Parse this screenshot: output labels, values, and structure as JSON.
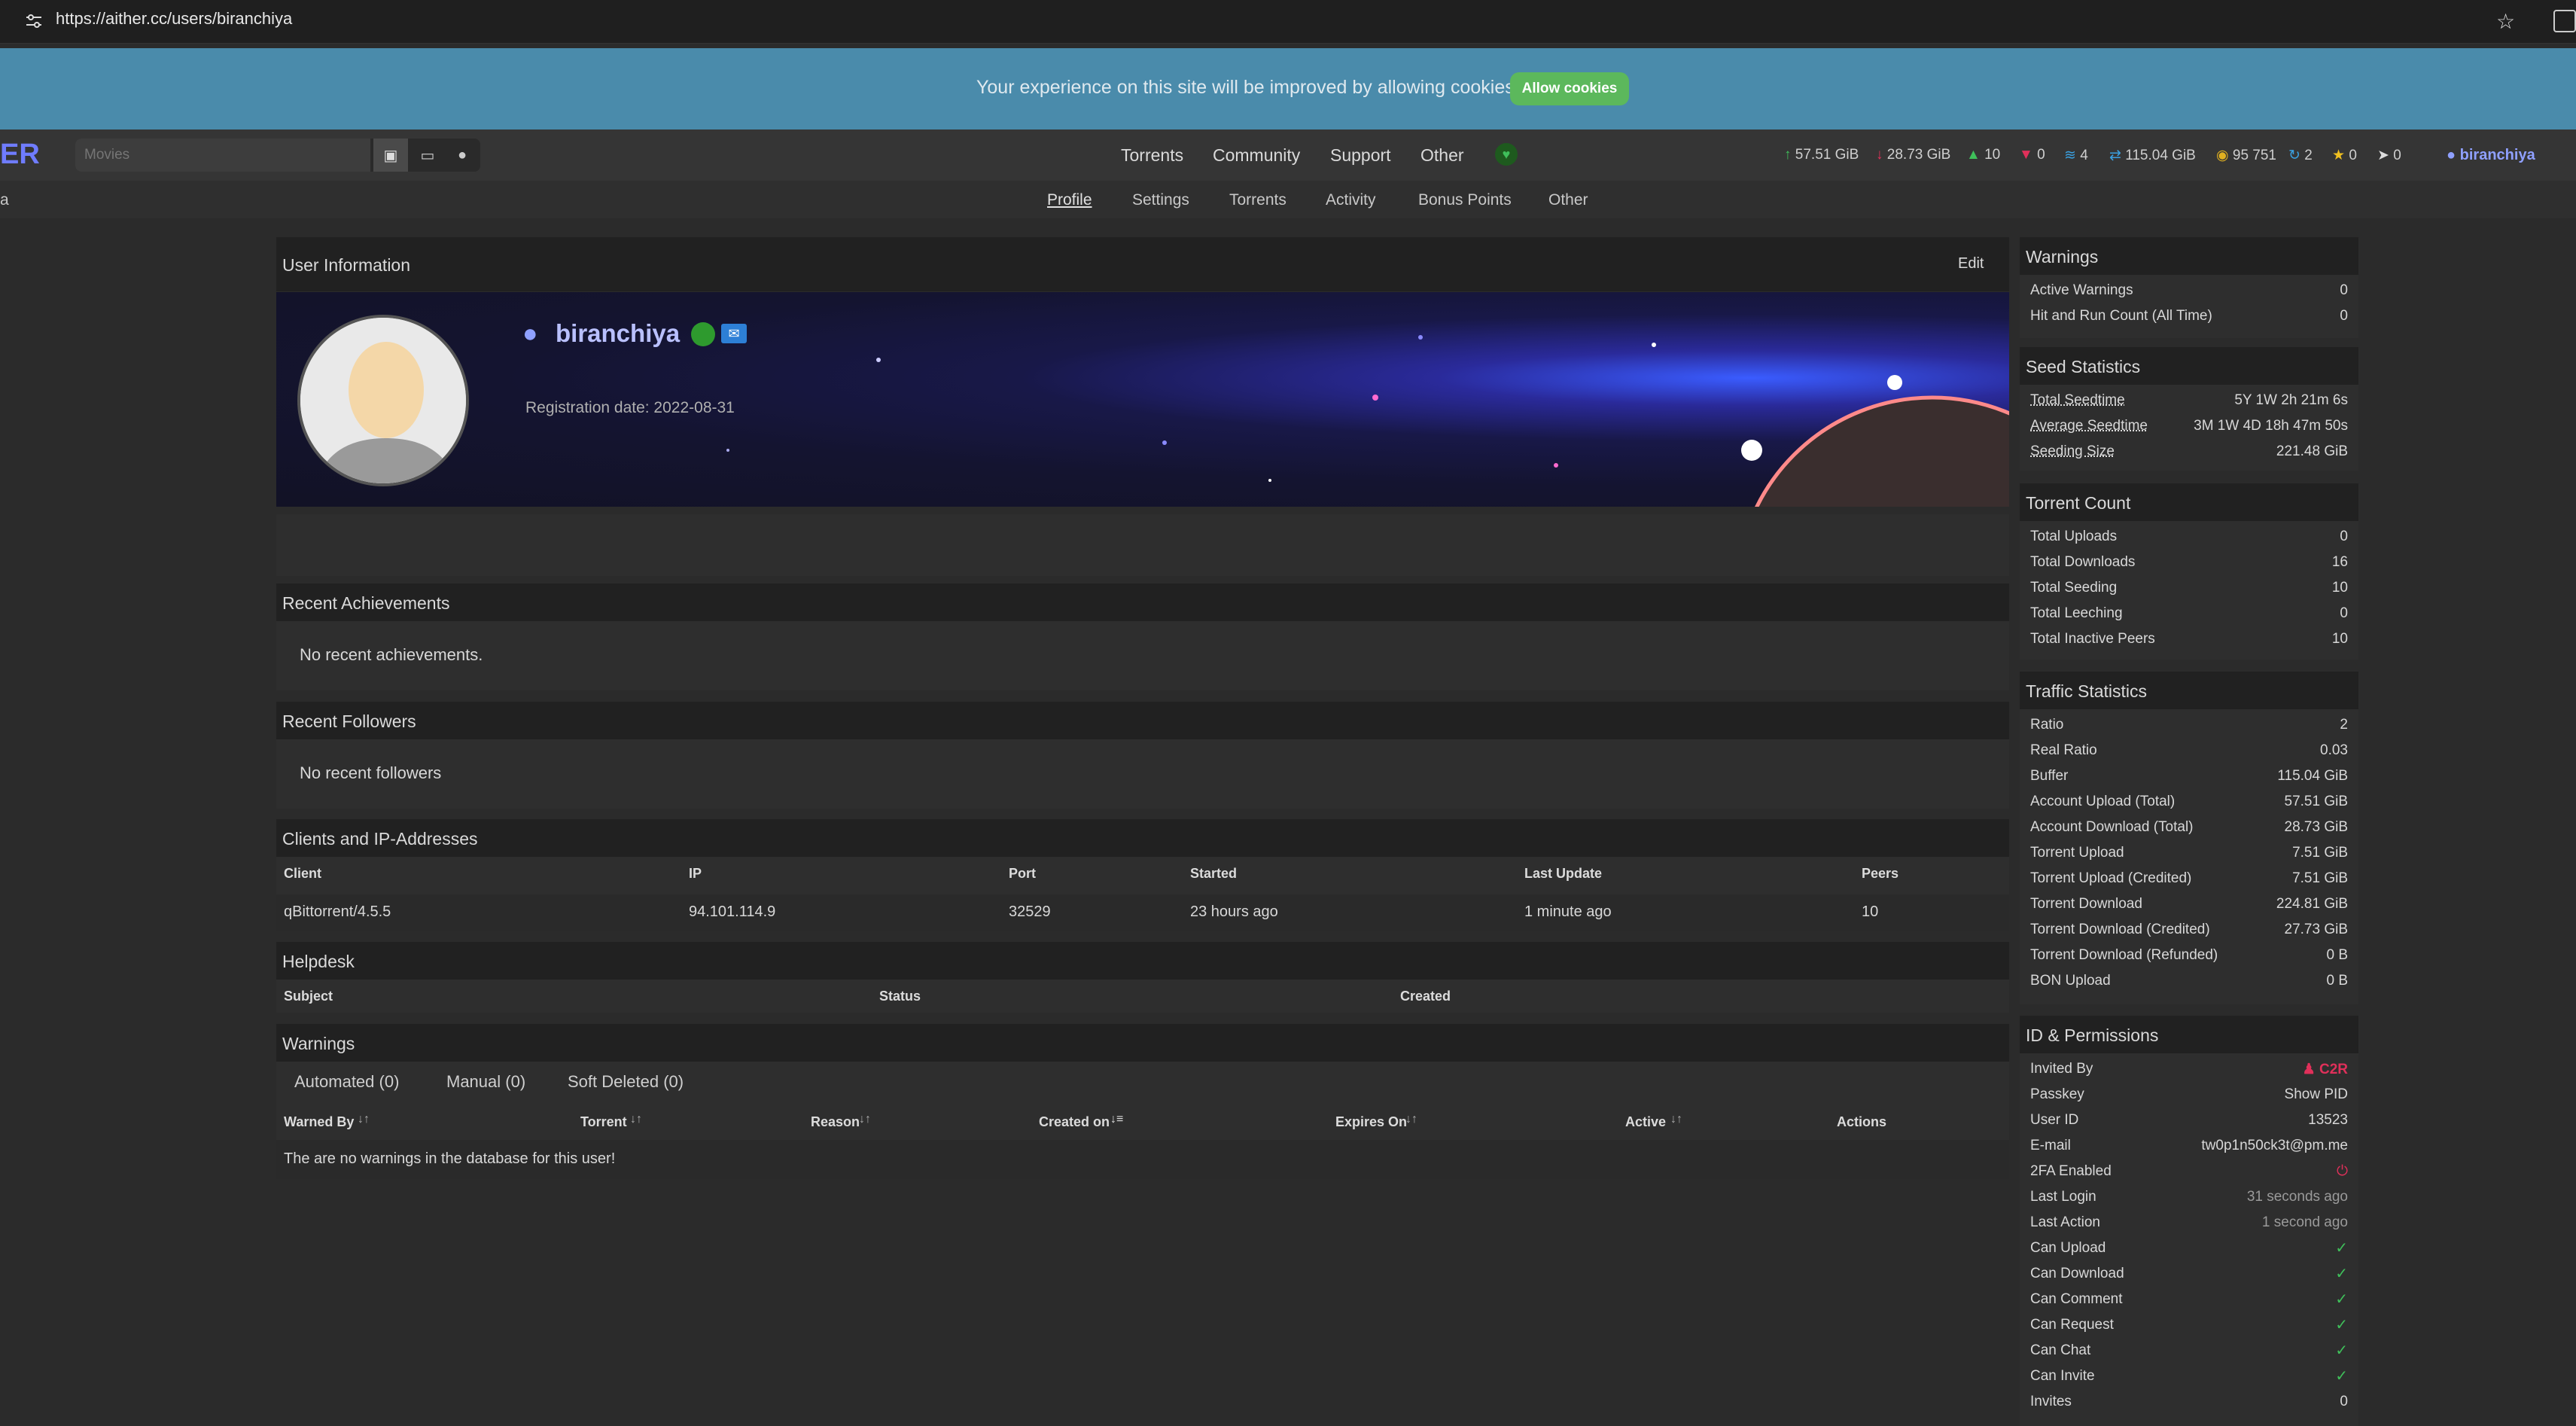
{
  "browser": {
    "url": "https://aither.cc/users/biranchiya"
  },
  "cookie": {
    "message": "Your experience on this site will be improved by allowing cookies.",
    "button": "Allow cookies"
  },
  "topnav": {
    "logo_fragment": "ER",
    "search_placeholder": "Movies",
    "menu": [
      "Torrents",
      "Community",
      "Support",
      "Other"
    ],
    "stats": {
      "upload": "57.51 GiB",
      "download": "28.73 GiB",
      "seeding": "10",
      "leeching": "0",
      "connectable": "4",
      "buffer": "115.04 GiB",
      "bon": "95 751",
      "hnr": "2",
      "fl": "0",
      "invites": "0"
    },
    "username": "biranchiya"
  },
  "subnav": {
    "left_fragment": "a",
    "tabs": [
      "Profile",
      "Settings",
      "Torrents",
      "Activity",
      "Bonus Points",
      "Other"
    ]
  },
  "profile": {
    "title": "User Information",
    "edit": "Edit",
    "username": "biranchiya",
    "registration": "Registration date: 2022-08-31"
  },
  "achievements": {
    "title": "Recent Achievements",
    "empty": "No recent achievements."
  },
  "followers": {
    "title": "Recent Followers",
    "empty": "No recent followers"
  },
  "clients": {
    "title": "Clients and IP-Addresses",
    "headers": [
      "Client",
      "IP",
      "Port",
      "Started",
      "Last Update",
      "Peers"
    ],
    "rows": [
      [
        "qBittorrent/4.5.5",
        "94.101.114.9",
        "32529",
        "23 hours ago",
        "1 minute ago",
        "10"
      ]
    ]
  },
  "helpdesk": {
    "title": "Helpdesk",
    "headers": [
      "Subject",
      "Status",
      "Created"
    ]
  },
  "warnings_main": {
    "title": "Warnings",
    "tabs": [
      "Automated (0)",
      "Manual (0)",
      "Soft Deleted (0)"
    ],
    "headers": [
      "Warned By",
      "Torrent",
      "Reason",
      "Created on",
      "Expires On",
      "Active",
      "Actions"
    ],
    "empty": "The are no warnings in the database for this user!"
  },
  "side_warnings": {
    "title": "Warnings",
    "rows": [
      [
        "Active Warnings",
        "0"
      ],
      [
        "Hit and Run Count (All Time)",
        "0"
      ]
    ]
  },
  "seed_stats": {
    "title": "Seed Statistics",
    "rows": [
      [
        "Total Seedtime",
        "5Y 1W 2h 21m 6s"
      ],
      [
        "Average Seedtime",
        "3M 1W 4D 18h 47m 50s"
      ],
      [
        "Seeding Size",
        "221.48 GiB"
      ]
    ]
  },
  "torrent_count": {
    "title": "Torrent Count",
    "rows": [
      [
        "Total Uploads",
        "0"
      ],
      [
        "Total Downloads",
        "16"
      ],
      [
        "Total Seeding",
        "10"
      ],
      [
        "Total Leeching",
        "0"
      ],
      [
        "Total Inactive Peers",
        "10"
      ]
    ]
  },
  "traffic": {
    "title": "Traffic Statistics",
    "rows": [
      [
        "Ratio",
        "2"
      ],
      [
        "Real Ratio",
        "0.03"
      ],
      [
        "Buffer",
        "115.04 GiB"
      ],
      [
        "Account Upload (Total)",
        "57.51 GiB"
      ],
      [
        "Account Download (Total)",
        "28.73 GiB"
      ],
      [
        "Torrent Upload",
        "7.51 GiB"
      ],
      [
        "Torrent Upload (Credited)",
        "7.51 GiB"
      ],
      [
        "Torrent Download",
        "224.81 GiB"
      ],
      [
        "Torrent Download (Credited)",
        "27.73 GiB"
      ],
      [
        "Torrent Download (Refunded)",
        "0 B"
      ],
      [
        "BON Upload",
        "0 B"
      ]
    ]
  },
  "idperm": {
    "title": "ID & Permissions",
    "rows": [
      [
        "Invited By",
        "C2R"
      ],
      [
        "Passkey",
        "Show PID"
      ],
      [
        "User ID",
        "13523"
      ],
      [
        "E-mail",
        "tw0p1n50ck3t@pm.me"
      ],
      [
        "2FA Enabled",
        ""
      ],
      [
        "Last Login",
        "31 seconds ago"
      ],
      [
        "Last Action",
        "1 second ago"
      ],
      [
        "Can Upload",
        ""
      ],
      [
        "Can Download",
        ""
      ],
      [
        "Can Comment",
        ""
      ],
      [
        "Can Request",
        ""
      ],
      [
        "Can Chat",
        ""
      ],
      [
        "Can Invite",
        ""
      ],
      [
        "Invites",
        "0"
      ]
    ]
  },
  "colors": {
    "accent": "#6f7cff",
    "success": "#3fbf5a",
    "danger": "#e0305a",
    "cookie_bg": "#4a8bab"
  }
}
